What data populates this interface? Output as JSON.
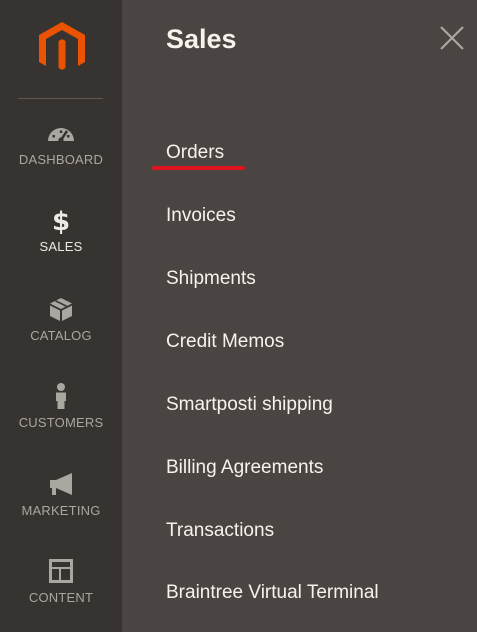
{
  "sidebar": {
    "items": [
      {
        "label": "DASHBOARD",
        "icon": "dashboard-icon"
      },
      {
        "label": "SALES",
        "icon": "dollar-icon"
      },
      {
        "label": "CATALOG",
        "icon": "box-icon"
      },
      {
        "label": "CUSTOMERS",
        "icon": "person-icon"
      },
      {
        "label": "MARKETING",
        "icon": "megaphone-icon"
      },
      {
        "label": "CONTENT",
        "icon": "layout-icon"
      }
    ]
  },
  "panel": {
    "title": "Sales",
    "items": [
      {
        "label": "Orders",
        "highlighted": true
      },
      {
        "label": "Invoices"
      },
      {
        "label": "Shipments"
      },
      {
        "label": "Credit Memos"
      },
      {
        "label": "Smartposti shipping"
      },
      {
        "label": "Billing Agreements"
      },
      {
        "label": "Transactions"
      },
      {
        "label": "Braintree Virtual Terminal"
      }
    ]
  },
  "colors": {
    "rail_bg": "#373330",
    "panel_bg": "#4a4542",
    "brand_orange": "#eb5202",
    "highlight_underline": "#e0141e",
    "text_light": "#f7f3eb",
    "rail_text": "#aaa6a0"
  }
}
